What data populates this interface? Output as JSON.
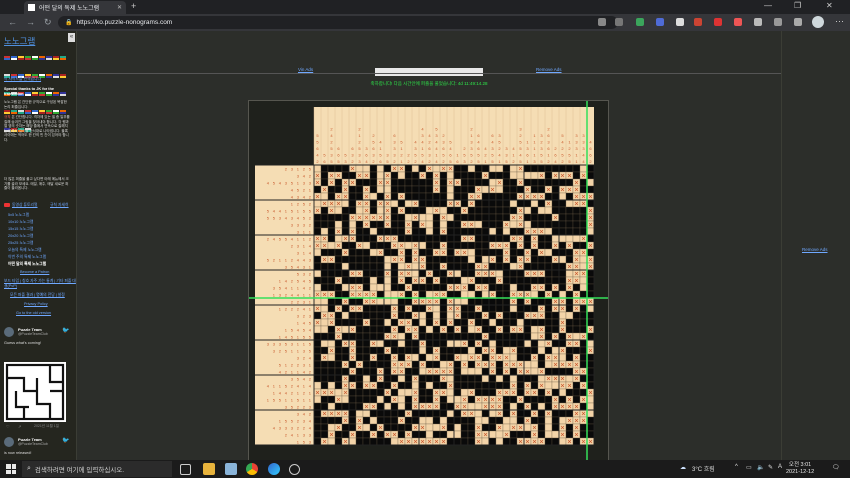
{
  "browser": {
    "tab_title": "어떤 달의 독제 노노그램",
    "url": "https://ko.puzzle-nonograms.com",
    "new_tab": "+",
    "window_controls": [
      "—",
      "❐",
      "✕"
    ]
  },
  "sidebar": {
    "logo": "노노그램",
    "collapse": "«",
    "translate_link": "이 사이트를 번역합니다",
    "thanks": "Special thanks to JK for the translation",
    "intro": "노노그램 은 간단한 규칙으로 구성된 복잡한 논리 퍼즐입니다.",
    "rules_label": "규칙",
    "rules_text": "은 간단합니다. 격자에 있는 셀 중 일부를 칠해 숨겨진 그림을 찾아내야 합니다. 각 행과 열 옆의 숫자는 해당 줄에서 연속으로 칠해지는 블록의 길이를 순서대로 나타냅니다. 블록 사이에는 적어도 한 칸의 빈 칸이 있어야 합니다.",
    "more_text": "더 많은 퍼즐을 풀고 싶다면 아래 메뉴에서 크기를 골라 보세요. 매일, 매주, 매달 새로운 퍼즐이 올라옵니다.",
    "youtube": "동영상 튜토리얼",
    "rules_link": "규칙 자세히",
    "menu": [
      "5x5 노노그램",
      "10x10 노노그램",
      "15x15 노노그램",
      "20x20 노노그램",
      "25x25 노노그램",
      "오늘의 특제 노노그램",
      "이번 주의 특제 노노그램",
      "어떤 달의 특제 노노그램"
    ],
    "patron": "Become a Patron",
    "links1": "보드 타입 | 칭호 자주 가는 통계 | 기타 퍼즐 대결(PvP)",
    "links2": "모든 퍼즐 결과 | 명예의 전당 | 설정",
    "privacy": "Privacy Policy",
    "old_version": "Go to the old version"
  },
  "tweets": [
    {
      "name": "Puzzle Team",
      "handle": "@PuzzleTeamClub",
      "text": "Guess what's coming!",
      "date": "2021년 11월 1일"
    },
    {
      "name": "Puzzle Team",
      "handle": "@PuzzleTeamClub",
      "text": "is now released!"
    }
  ],
  "main": {
    "ad_left": "Vin Ads",
    "ad_right": "Remove Ads",
    "notice": "축하합니다! 다음 시간안에 퍼즐을 풀었습니다: 4d 11:49:14.28",
    "right_ad": "Remove Ads",
    "grid": {
      "cols": 40,
      "rows": 40,
      "clue_cols": 9,
      "clue_rows": 8
    }
  },
  "taskbar": {
    "search_placeholder": "검색하려면 여기에 입력하십시오.",
    "weather": "3°C  흐림",
    "ime": "A",
    "time": "오전 3:01",
    "date": "2021-12-12"
  },
  "colors": {
    "filled": "#0a0a0a",
    "empty": "#f3d4a8",
    "clue_bg": "#f5ddb4",
    "highlight": "#35e05a"
  }
}
